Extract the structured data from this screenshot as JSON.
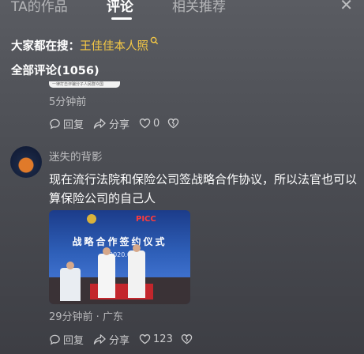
{
  "tabs": [
    {
      "label": "TA的作品",
      "active": false
    },
    {
      "label": "评论",
      "active": true
    },
    {
      "label": "相关推荐",
      "active": false
    }
  ],
  "close_icon": "close-icon",
  "search": {
    "prefix": "大家都在搜：",
    "keyword": "王佳佳本人照",
    "icon": "search-icon",
    "keyword_color": "#f6c945"
  },
  "comments_header": "全部评论(1056)",
  "comments": [
    {
      "image_caption": "一律打击诈骗分子人民群众国",
      "time": "5分钟前",
      "reply_label": "回复",
      "share_label": "分享",
      "likes": "0"
    },
    {
      "username": "迷失的背影",
      "text": "现在流行法院和保险公司签战略合作协议，所以法官也可以算保险公司的自己人",
      "photo": {
        "logo": "PICC",
        "title": "战略合作签约仪式",
        "subtitle": "2020.0"
      },
      "time": "29分钟前 · 广东",
      "reply_label": "回复",
      "share_label": "分享",
      "likes": "123"
    }
  ]
}
